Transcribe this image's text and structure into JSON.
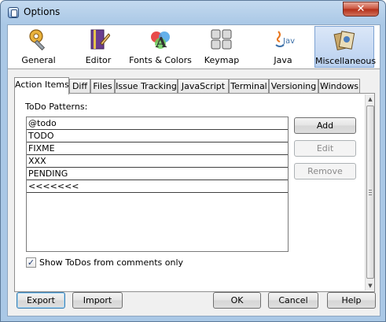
{
  "window": {
    "title": "Options",
    "close_glyph": "✕"
  },
  "categories": [
    {
      "label": "General",
      "icon": "gear-wrench-icon"
    },
    {
      "label": "Editor",
      "icon": "editor-pencil-icon"
    },
    {
      "label": "Fonts & Colors",
      "icon": "font-palette-icon"
    },
    {
      "label": "Keymap",
      "icon": "keyboard-icon"
    },
    {
      "label": "Java",
      "icon": "java-logo-icon"
    },
    {
      "label": "Miscellaneous",
      "icon": "misc-icon",
      "selected": true
    }
  ],
  "tabs": [
    "Action Items",
    "Diff",
    "Files",
    "Issue Tracking",
    "JavaScript",
    "Terminal",
    "Versioning",
    "Windows"
  ],
  "active_tab": "Action Items",
  "todo": {
    "label": "ToDo Patterns:",
    "patterns": [
      "@todo",
      "TODO",
      "FIXME",
      "XXX",
      "PENDING",
      "<<<<<<<"
    ]
  },
  "side_buttons": {
    "add": "Add",
    "edit": "Edit",
    "remove": "Remove"
  },
  "show_todos": {
    "label": "Show ToDos from comments only",
    "checked": true
  },
  "bottom_buttons": {
    "export": "Export",
    "import": "Import",
    "ok": "OK",
    "cancel": "Cancel",
    "help": "Help"
  },
  "colors": {
    "title_bar": "#aac8e6",
    "selected_category": "#b9d0ef",
    "close_button": "#c8503a"
  }
}
